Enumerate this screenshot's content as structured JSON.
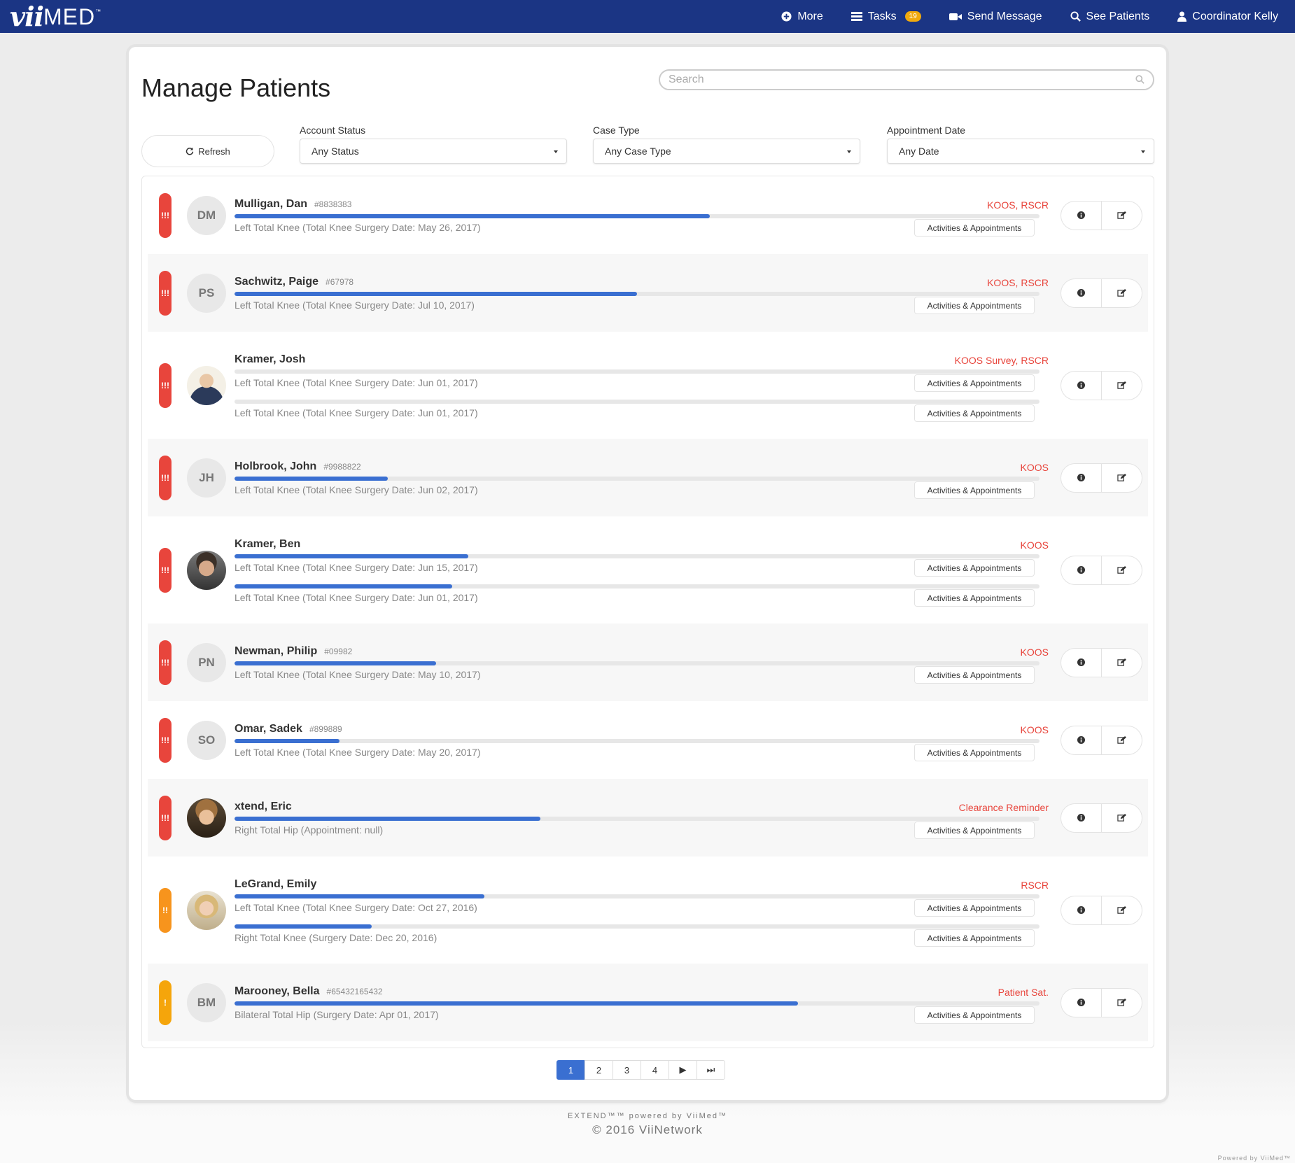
{
  "brand": {
    "logo_vii": "vii",
    "logo_med": "MED",
    "logo_tm": "™"
  },
  "nav": {
    "more": "More",
    "tasks": "Tasks",
    "tasks_badge": "19",
    "send_message": "Send Message",
    "see_patients": "See Patients",
    "user": "Coordinator Kelly"
  },
  "page": {
    "title": "Manage Patients"
  },
  "search": {
    "placeholder": "Search"
  },
  "filters": {
    "refresh": "Refresh",
    "account_status": {
      "label": "Account Status",
      "value": "Any Status"
    },
    "case_type": {
      "label": "Case Type",
      "value": "Any Case Type"
    },
    "appointment_date": {
      "label": "Appointment Date",
      "value": "Any Date"
    }
  },
  "colors": {
    "accent": "#3a6fd1",
    "nav_bg": "#1b3584",
    "alert_high": "#e8453c",
    "alert_mid": "#f7941d",
    "alert_low": "#f5a50b",
    "badge": "#f0a90e"
  },
  "patients": [
    {
      "name": "Mulligan, Dan",
      "id": "#8838383",
      "initials": "DM",
      "flag": "!!!",
      "flag_level": "high",
      "tags": "KOOS, RSCR",
      "cases": [
        {
          "text": "Left Total Knee (Total Knee Surgery Date: May 26, 2017)",
          "progress": 0.59,
          "action": "Activities & Appointments"
        }
      ]
    },
    {
      "name": "Sachwitz, Paige",
      "id": "#67978",
      "initials": "PS",
      "flag": "!!!",
      "flag_level": "high",
      "tags": "KOOS, RSCR",
      "cases": [
        {
          "text": "Left Total Knee (Total Knee Surgery Date: Jul 10, 2017)",
          "progress": 0.5,
          "action": "Activities & Appointments"
        }
      ]
    },
    {
      "name": "Kramer, Josh",
      "id": "",
      "initials": "",
      "photo": "avatar-photo",
      "flag": "!!!",
      "flag_level": "high",
      "tags": "KOOS Survey, RSCR",
      "cases": [
        {
          "text": "Left Total Knee (Total Knee Surgery Date: Jun 01, 2017)",
          "progress": 0,
          "action": "Activities & Appointments"
        },
        {
          "text": "Left Total Knee (Total Knee Surgery Date: Jun 01, 2017)",
          "progress": 0,
          "action": "Activities & Appointments"
        }
      ]
    },
    {
      "name": "Holbrook, John",
      "id": "#9988822",
      "initials": "JH",
      "flag": "!!!",
      "flag_level": "high",
      "tags": "KOOS",
      "cases": [
        {
          "text": "Left Total Knee (Total Knee Surgery Date: Jun 02, 2017)",
          "progress": 0.19,
          "action": "Activities & Appointments"
        }
      ]
    },
    {
      "name": "Kramer, Ben",
      "id": "",
      "initials": "",
      "photo": "avatar-photo",
      "flag": "!!!",
      "flag_level": "high",
      "tags": "KOOS",
      "cases": [
        {
          "text": "Left Total Knee (Total Knee Surgery Date: Jun 15, 2017)",
          "progress": 0.29,
          "action": "Activities & Appointments"
        },
        {
          "text": "Left Total Knee (Total Knee Surgery Date: Jun 01, 2017)",
          "progress": 0.27,
          "action": "Activities & Appointments"
        }
      ]
    },
    {
      "name": "Newman, Philip",
      "id": "#09982",
      "initials": "PN",
      "flag": "!!!",
      "flag_level": "high",
      "tags": "KOOS",
      "cases": [
        {
          "text": "Left Total Knee (Total Knee Surgery Date: May 10, 2017)",
          "progress": 0.25,
          "action": "Activities & Appointments"
        }
      ]
    },
    {
      "name": "Omar, Sadek",
      "id": "#899889",
      "initials": "SO",
      "flag": "!!!",
      "flag_level": "high",
      "tags": "KOOS",
      "cases": [
        {
          "text": "Left Total Knee (Total Knee Surgery Date: May 20, 2017)",
          "progress": 0.13,
          "action": "Activities & Appointments"
        }
      ]
    },
    {
      "name": "xtend, Eric",
      "id": "",
      "initials": "",
      "photo": "avatar-photo",
      "flag": "!!!",
      "flag_level": "high",
      "tags": "Clearance Reminder",
      "cases": [
        {
          "text": "Right Total Hip (Appointment: null)",
          "progress": 0.38,
          "action": "Activities & Appointments"
        }
      ]
    },
    {
      "name": "LeGrand, Emily",
      "id": "",
      "initials": "",
      "photo": "avatar-photo",
      "flag": "!!",
      "flag_level": "mid",
      "tags": "RSCR",
      "cases": [
        {
          "text": "Left Total Knee (Total Knee Surgery Date: Oct 27, 2016)",
          "progress": 0.31,
          "action": "Activities & Appointments"
        },
        {
          "text": "Right Total Knee (Surgery Date: Dec 20, 2016)",
          "progress": 0.17,
          "action": "Activities & Appointments"
        }
      ]
    },
    {
      "name": "Marooney, Bella",
      "id": "#65432165432",
      "initials": "BM",
      "flag": "!",
      "flag_level": "low",
      "tags": "Patient Sat.",
      "cases": [
        {
          "text": "Bilateral Total Hip (Surgery Date: Apr 01, 2017)",
          "progress": 0.7,
          "action": "Activities & Appointments"
        }
      ]
    }
  ],
  "pagination": {
    "pages": [
      "1",
      "2",
      "3",
      "4"
    ],
    "current": "1",
    "next": "▶",
    "last": "⏭"
  },
  "footer": {
    "line1": "EXTEND™™ powered by ViiMed™",
    "line2": "© 2016 ViiNetwork",
    "corner": "Powered by ViiMed™"
  }
}
